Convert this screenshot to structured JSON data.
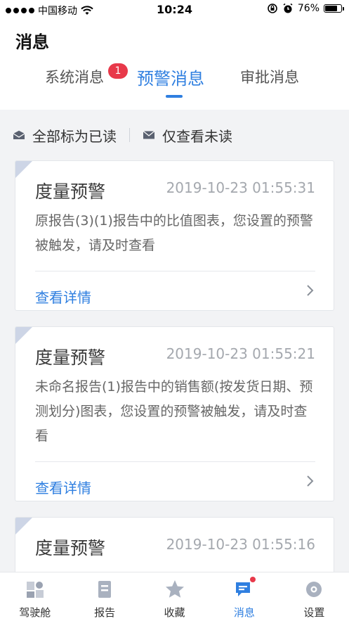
{
  "status_bar": {
    "carrier": "中国移动",
    "time": "10:24",
    "battery": "76%",
    "battery_level": 0.76
  },
  "header": {
    "title": "消息"
  },
  "tabs": [
    {
      "label": "系统消息",
      "badge": "1",
      "active": false
    },
    {
      "label": "预警消息",
      "active": true
    },
    {
      "label": "审批消息",
      "active": false
    }
  ],
  "actions": {
    "mark_all_read": "全部标为已读",
    "unread_only": "仅查看未读"
  },
  "cards": [
    {
      "title": "度量预警",
      "time": "2019-10-23 01:55:31",
      "body": "原报告(3)(1)报告中的比值图表，您设置的预警被触发，请及时查看",
      "link": "查看详情"
    },
    {
      "title": "度量预警",
      "time": "2019-10-23 01:55:21",
      "body": "未命名报告(1)报告中的销售额(按发货日期、预测划分)图表，您设置的预警被触发，请及时查看",
      "link": "查看详情"
    },
    {
      "title": "度量预警",
      "time": "2019-10-23 01:55:16"
    }
  ],
  "bottom_nav": [
    {
      "label": "驾驶舱",
      "icon": "cockpit-icon",
      "active": false
    },
    {
      "label": "报告",
      "icon": "report-icon",
      "active": false
    },
    {
      "label": "收藏",
      "icon": "star-icon",
      "active": false
    },
    {
      "label": "消息",
      "icon": "message-icon",
      "active": true
    },
    {
      "label": "设置",
      "icon": "settings-icon",
      "active": false
    }
  ],
  "colors": {
    "accent": "#2f7fe0",
    "badge": "#e8394a",
    "background": "#f2f3f5"
  }
}
